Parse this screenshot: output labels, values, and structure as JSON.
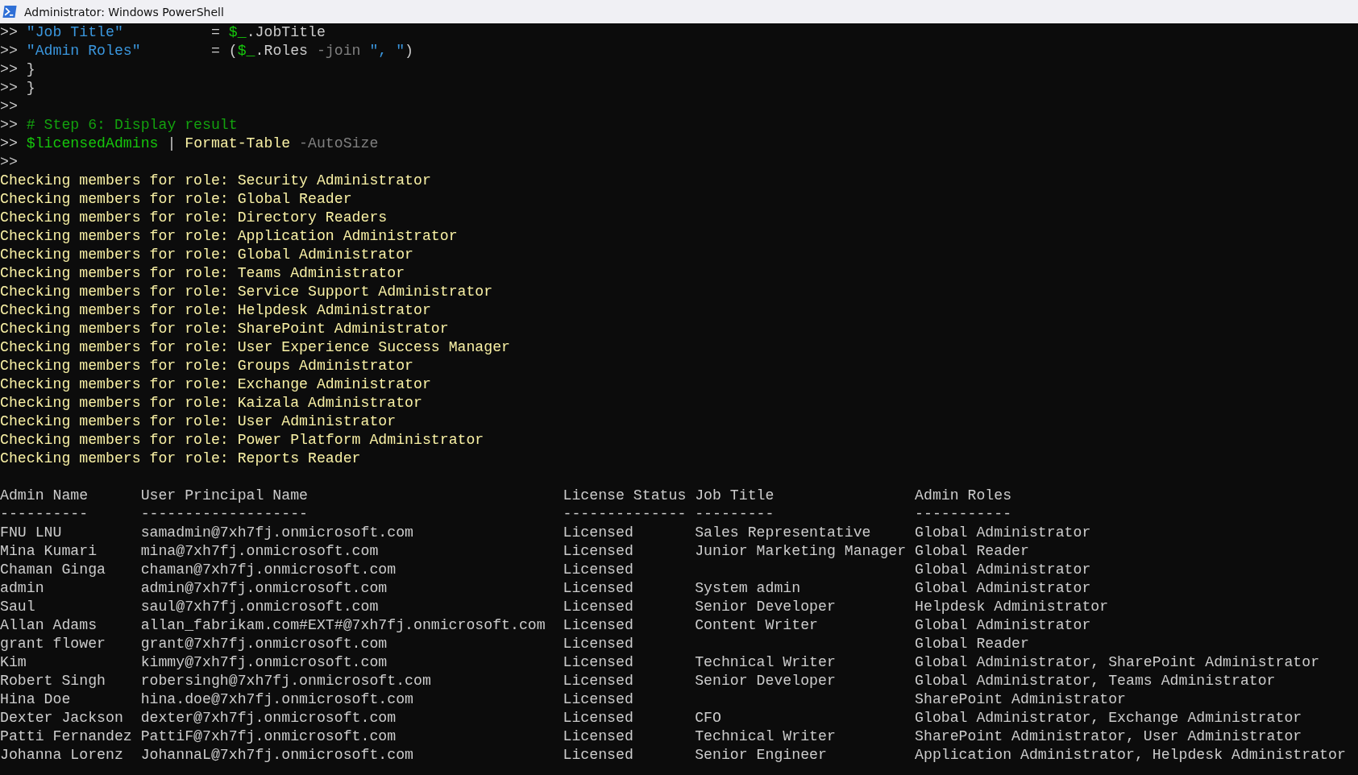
{
  "window": {
    "title": "Administrator: Windows PowerShell"
  },
  "console": {
    "lines": [
      {
        "kind": "command",
        "segments": [
          {
            "kind": "prompt",
            "text": ">> "
          },
          {
            "kind": "string",
            "text": "\"Job Title\""
          },
          {
            "kind": "plain",
            "text": "          = "
          },
          {
            "kind": "variable",
            "text": "$_"
          },
          {
            "kind": "plain",
            "text": ".JobTitle"
          }
        ]
      },
      {
        "kind": "command",
        "segments": [
          {
            "kind": "prompt",
            "text": ">> "
          },
          {
            "kind": "string",
            "text": "\"Admin Roles\""
          },
          {
            "kind": "plain",
            "text": "        = ("
          },
          {
            "kind": "variable",
            "text": "$_"
          },
          {
            "kind": "plain",
            "text": ".Roles "
          },
          {
            "kind": "parameter",
            "text": "-join"
          },
          {
            "kind": "string",
            "text": " \", \""
          },
          {
            "kind": "plain",
            "text": ")"
          }
        ]
      },
      {
        "kind": "command",
        "segments": [
          {
            "kind": "prompt",
            "text": ">> "
          },
          {
            "kind": "plain",
            "text": "}"
          }
        ]
      },
      {
        "kind": "command",
        "segments": [
          {
            "kind": "prompt",
            "text": ">> "
          },
          {
            "kind": "plain",
            "text": "}"
          }
        ]
      },
      {
        "kind": "command",
        "segments": [
          {
            "kind": "prompt",
            "text": ">>"
          }
        ]
      },
      {
        "kind": "command",
        "segments": [
          {
            "kind": "prompt",
            "text": ">> "
          },
          {
            "kind": "comment",
            "text": "# Step 6: Display result"
          }
        ]
      },
      {
        "kind": "command",
        "segments": [
          {
            "kind": "prompt",
            "text": ">> "
          },
          {
            "kind": "variable",
            "text": "$licensedAdmins"
          },
          {
            "kind": "plain",
            "text": " | "
          },
          {
            "kind": "cmdlet",
            "text": "Format-Table"
          },
          {
            "kind": "parameter",
            "text": " -AutoSize"
          }
        ]
      },
      {
        "kind": "command",
        "segments": [
          {
            "kind": "prompt",
            "text": ">>"
          }
        ]
      },
      {
        "kind": "output",
        "text": "Checking members for role: Security Administrator"
      },
      {
        "kind": "output",
        "text": "Checking members for role: Global Reader"
      },
      {
        "kind": "output",
        "text": "Checking members for role: Directory Readers"
      },
      {
        "kind": "output",
        "text": "Checking members for role: Application Administrator"
      },
      {
        "kind": "output",
        "text": "Checking members for role: Global Administrator"
      },
      {
        "kind": "output",
        "text": "Checking members for role: Teams Administrator"
      },
      {
        "kind": "output",
        "text": "Checking members for role: Service Support Administrator"
      },
      {
        "kind": "output",
        "text": "Checking members for role: Helpdesk Administrator"
      },
      {
        "kind": "output",
        "text": "Checking members for role: SharePoint Administrator"
      },
      {
        "kind": "output",
        "text": "Checking members for role: User Experience Success Manager"
      },
      {
        "kind": "output",
        "text": "Checking members for role: Groups Administrator"
      },
      {
        "kind": "output",
        "text": "Checking members for role: Exchange Administrator"
      },
      {
        "kind": "output",
        "text": "Checking members for role: Kaizala Administrator"
      },
      {
        "kind": "output",
        "text": "Checking members for role: User Administrator"
      },
      {
        "kind": "output",
        "text": "Checking members for role: Power Platform Administrator"
      },
      {
        "kind": "output",
        "text": "Checking members for role: Reports Reader"
      }
    ],
    "table": {
      "columns": [
        {
          "name": "Admin Name",
          "underline": "----------"
        },
        {
          "name": "User Principal Name",
          "underline": "-------------------"
        },
        {
          "name": "License Status",
          "underline": "--------------"
        },
        {
          "name": "Job Title",
          "underline": "---------"
        },
        {
          "name": "Admin Roles",
          "underline": "-----------"
        }
      ],
      "rows": [
        [
          "FNU LNU",
          "samadmin@7xh7fj.onmicrosoft.com",
          "Licensed",
          "Sales Representative",
          "Global Administrator"
        ],
        [
          "Mina Kumari",
          "mina@7xh7fj.onmicrosoft.com",
          "Licensed",
          "Junior Marketing Manager",
          "Global Reader"
        ],
        [
          "Chaman Ginga",
          "chaman@7xh7fj.onmicrosoft.com",
          "Licensed",
          null,
          "Global Administrator"
        ],
        [
          "admin",
          "admin@7xh7fj.onmicrosoft.com",
          "Licensed",
          "System admin",
          "Global Administrator"
        ],
        [
          "Saul",
          "saul@7xh7fj.onmicrosoft.com",
          "Licensed",
          "Senior Developer",
          "Helpdesk Administrator"
        ],
        [
          "Allan Adams",
          "allan_fabrikam.com#EXT#@7xh7fj.onmicrosoft.com",
          "Licensed",
          "Content Writer",
          "Global Administrator"
        ],
        [
          "grant flower",
          "grant@7xh7fj.onmicrosoft.com",
          "Licensed",
          null,
          "Global Reader"
        ],
        [
          "Kim",
          "kimmy@7xh7fj.onmicrosoft.com",
          "Licensed",
          "Technical Writer",
          "Global Administrator, SharePoint Administrator"
        ],
        [
          "Robert Singh",
          "robersingh@7xh7fj.onmicrosoft.com",
          "Licensed",
          "Senior Developer",
          "Global Administrator, Teams Administrator"
        ],
        [
          "Hina Doe",
          "hina.doe@7xh7fj.onmicrosoft.com",
          "Licensed",
          null,
          "SharePoint Administrator"
        ],
        [
          "Dexter Jackson",
          "dexter@7xh7fj.onmicrosoft.com",
          "Licensed",
          "CFO",
          "Global Administrator, Exchange Administrator"
        ],
        [
          "Patti Fernandez",
          "PattiF@7xh7fj.onmicrosoft.com",
          "Licensed",
          "Technical Writer",
          "SharePoint Administrator, User Administrator"
        ],
        [
          "Johanna Lorenz",
          "JohannaL@7xh7fj.onmicrosoft.com",
          "Licensed",
          "Senior Engineer",
          "Application Administrator, Helpdesk Administrator"
        ]
      ]
    }
  }
}
